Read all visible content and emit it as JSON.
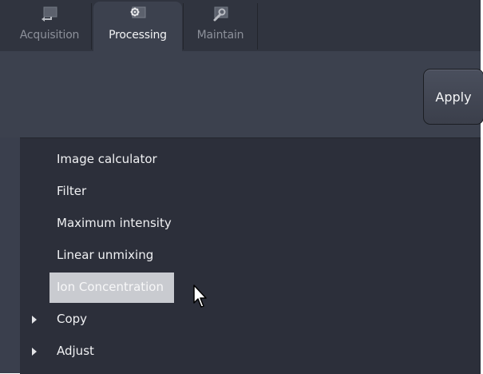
{
  "tabs": [
    {
      "label": "Acquisition",
      "icon": "acquisition-icon",
      "active": false
    },
    {
      "label": "Processing",
      "icon": "gear-icon",
      "active": true
    },
    {
      "label": "Maintain",
      "icon": "wrench-icon",
      "active": false
    }
  ],
  "toolbar": {
    "apply_label": "Apply"
  },
  "methods": [
    {
      "label": "Image calculator"
    },
    {
      "label": "Filter"
    },
    {
      "label": "Maximum intensity"
    },
    {
      "label": "Linear unmixing"
    },
    {
      "label": "Ion Concentration",
      "selected": true
    },
    {
      "label": "Copy",
      "expandable": true
    },
    {
      "label": "Adjust",
      "expandable": true
    }
  ],
  "colors": {
    "background": "#3a3f4d",
    "list_background": "#2c2f3a",
    "selection": "#c9cbd0",
    "text": "#f0f1f3"
  }
}
